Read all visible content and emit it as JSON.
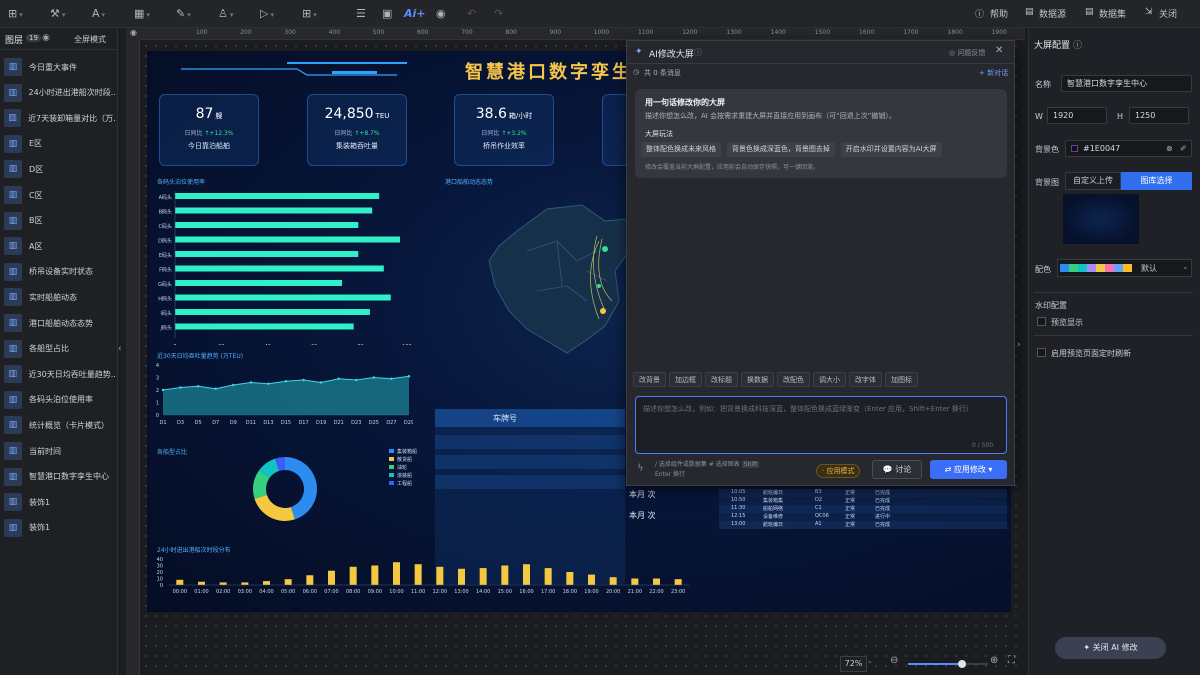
{
  "toolbar": {
    "help": "帮助",
    "datasource": "数据源",
    "dataset": "数据集",
    "close": "关闭",
    "ai_badge": "Ai+"
  },
  "layers": {
    "title": "图层",
    "count": "19",
    "fullscreen": "全屏模式",
    "items": [
      "今日重大事件",
      "24小时进出港船次时段...",
      "近7天装卸箱量对比（万...",
      "E区",
      "D区",
      "C区",
      "B区",
      "A区",
      "桥吊设备实时状态",
      "实时船舶动态",
      "港口船舶动态态势",
      "各船型占比",
      "近30天日均吞吐量趋势...",
      "各码头泊位使用率",
      "统计概览（卡片模式）",
      "当前时间",
      "智慧港口数字孪生中心",
      "装饰1",
      "装饰1"
    ]
  },
  "ruler_ticks": [
    "100",
    "200",
    "300",
    "400",
    "500",
    "600",
    "700",
    "800",
    "900",
    "1000",
    "1100",
    "1200",
    "1300",
    "1400",
    "1500",
    "1600",
    "1700",
    "1800",
    "1900"
  ],
  "canvas": {
    "title": "智慧港口数字孪生中心",
    "stats": [
      {
        "value": "87",
        "unit": "艘",
        "sub_label": "日同比",
        "sub_val": "↑+12.3%",
        "name": "今日靠泊船舶"
      },
      {
        "value": "24,850",
        "unit": "TEU",
        "sub_label": "日同比",
        "sub_val": "↑+8.7%",
        "name": "集装箱吞吐量"
      },
      {
        "value": "38.6",
        "unit": "箱/小时",
        "sub_label": "日同比",
        "sub_val": "↑+3.2%",
        "name": "桥吊作业效率"
      }
    ],
    "berth_title": "各码头泊位使用率",
    "map_title": "港口船舶动态态势",
    "trend_title": "近30天日均吞吐量趋势 (万TEU)",
    "pie_title": "各船型占比",
    "hourly_title": "24小时进出港船次时段分布",
    "table_header": "车牌号",
    "month_rows": [
      "本月 次",
      "本月 次"
    ],
    "ship_rows": [
      [
        "10:05",
        "航班编日",
        "B3",
        "正常",
        "已完成"
      ],
      [
        "10:50",
        "集装箱集",
        "D2",
        "正常",
        "已完成"
      ],
      [
        "11:30",
        "船舶网络",
        "C1",
        "正常",
        "已完成"
      ],
      [
        "12:15",
        "设备维修",
        "QC06",
        "正常",
        "进行中"
      ],
      [
        "13:00",
        "航班编日",
        "A1",
        "正常",
        "已完成"
      ]
    ]
  },
  "chart_data": [
    {
      "type": "bar",
      "title": "各码头泊位使用率",
      "categories": [
        "A码头",
        "B码头",
        "C码头",
        "D码头",
        "E码头",
        "F码头",
        "G码头",
        "H码头",
        "I码头",
        "J码头"
      ],
      "values": [
        88,
        85,
        79,
        97,
        79,
        90,
        72,
        93,
        84,
        77
      ],
      "xlim": [
        0,
        100
      ],
      "xticks": [
        "0",
        "20",
        "40",
        "60",
        "80",
        "100"
      ]
    },
    {
      "type": "area",
      "title": "近30天日均吞吐量趋势 (万TEU)",
      "x": [
        "D1",
        "D3",
        "D5",
        "D7",
        "D9",
        "D11",
        "D13",
        "D15",
        "D17",
        "D19",
        "D21",
        "D23",
        "D25",
        "D27",
        "D29"
      ],
      "values": [
        2.0,
        2.2,
        2.3,
        2.1,
        2.4,
        2.6,
        2.5,
        2.7,
        2.8,
        2.6,
        2.9,
        2.8,
        3.0,
        2.9,
        3.1
      ],
      "ylim": [
        0,
        4
      ],
      "yticks": [
        "0",
        "1",
        "2",
        "3",
        "4"
      ]
    },
    {
      "type": "pie",
      "title": "各船型占比",
      "labels": [
        "集装箱船",
        "散货船",
        "油轮",
        "滚装船",
        "工程船"
      ],
      "values": [
        45,
        25,
        15,
        10,
        5
      ],
      "colors": [
        "#2d8cf0",
        "#f5c842",
        "#35d07f",
        "#13c2c2",
        "#3d5afe"
      ]
    },
    {
      "type": "bar",
      "title": "24小时进出港船次时段分布",
      "categories": [
        "00:00",
        "01:00",
        "02:00",
        "03:00",
        "04:00",
        "05:00",
        "06:00",
        "07:00",
        "08:00",
        "09:00",
        "10:00",
        "11:00",
        "12:00",
        "13:00",
        "14:00",
        "15:00",
        "16:00",
        "17:00",
        "18:00",
        "19:00",
        "20:00",
        "21:00",
        "22:00",
        "23:00"
      ],
      "values": [
        8,
        5,
        4,
        4,
        6,
        9,
        15,
        22,
        28,
        30,
        35,
        32,
        28,
        25,
        26,
        30,
        32,
        26,
        20,
        16,
        12,
        10,
        10,
        9
      ],
      "ylim": [
        0,
        40
      ],
      "yticks": [
        "0",
        "10",
        "20",
        "30",
        "40"
      ]
    }
  ],
  "ai_panel": {
    "title": "AI修改大屏",
    "feedback": "问题反馈",
    "history": "共 0 条消息",
    "new_chat": "+ 新对话",
    "card_title": "用一句话修改你的大屏",
    "card_desc": "描述你想怎么改，AI 会按需求重建大屏并直接应用到画布（可“回退上次”撤销）。",
    "examples_title": "大屏玩法",
    "examples": [
      "整体配色换成未来风格",
      "背景色换成深蓝色，背景图去掉",
      "开启水印并设置内容为AI大屏"
    ],
    "card_note": "修改会覆盖当前大屏配置，应用前会自动保存快照，可一键回滚。",
    "quick_chips": [
      "改背景",
      "加边框",
      "改标题",
      "换数据",
      "改配色",
      "调大小",
      "改字体",
      "加图标"
    ],
    "input_placeholder": "描述你想怎么改，例如：把背景换成科技深蓝，整体配色换成蓝绿渐变（Enter 应用，Shift+Enter 换行）",
    "char_count": "0 / 500",
    "hint1": "/ 选择组件或数据集",
    "hint2": "# 选择图表",
    "hint_key": "Shift",
    "hint_enter": "Enter 换行",
    "mode_label": "应用模式",
    "discuss": "讨论",
    "apply": "应用修改"
  },
  "config": {
    "title": "大屏配置",
    "name_label": "名称",
    "name_value": "智慧港口数字孪生中心",
    "w_label": "W",
    "w_value": "1920",
    "h_label": "H",
    "h_value": "1250",
    "bgcolor_label": "背景色",
    "bgcolor_value": "#1E0047",
    "bgimage_label": "背景图",
    "tab_custom": "自定义上传",
    "tab_gallery": "图库选择",
    "palette_label": "配色",
    "palette_value": "默认",
    "palette_colors": [
      "#2d8cf0",
      "#35d07f",
      "#13c2c2",
      "#a78bfa",
      "#f5c842",
      "#f472b6",
      "#60a5fa",
      "#fbbf24"
    ],
    "watermark_title": "水印配置",
    "preview_label": "预览显示",
    "refresh_label": "启用预览页面定时刷新",
    "close_ai": "关闭 AI 修改"
  },
  "zoom": {
    "value": "72%"
  }
}
